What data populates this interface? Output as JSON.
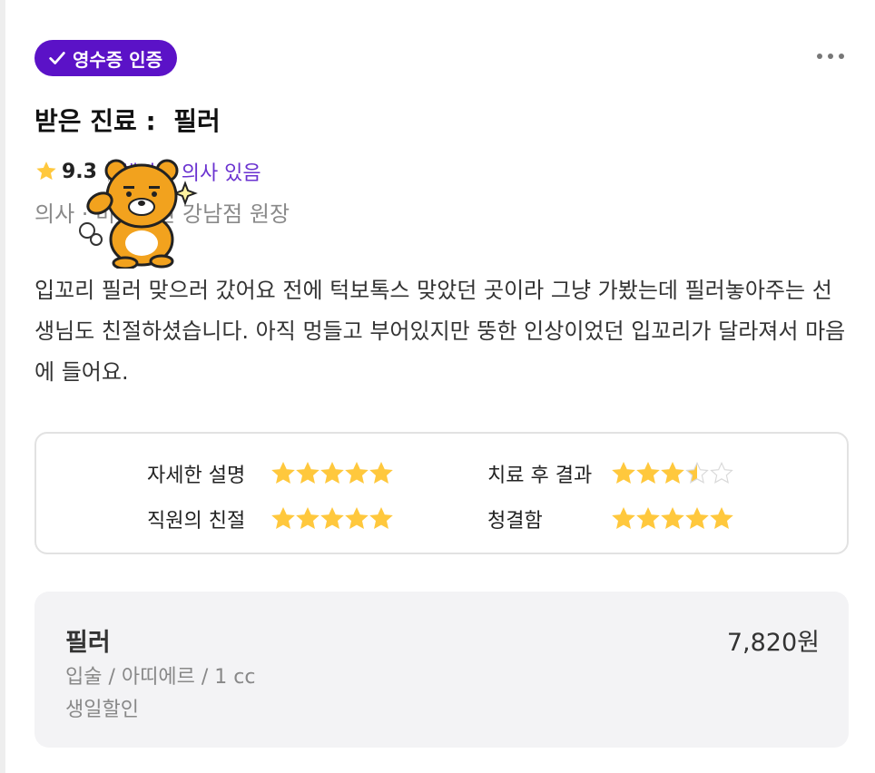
{
  "review": {
    "badge_label": "영수증 인증",
    "title": "받은 진료 :  필러",
    "rating": "9.3",
    "doctor_link": "해당문 의사 있음",
    "doctor_info": "의사 · 미인의원 강남점 원장",
    "text": "입꼬리 필러 맞으러 갔어요 전에 턱보톡스 맞았던 곳이라 그냥 가봤는데 필러놓아주는 선생님도 친절하셨습니다. 아직 멍들고 부어있지만 뚱한 인상이었던 입꼬리가 달라져서 마음에 들어요."
  },
  "scores": [
    {
      "label": "자세한 설명",
      "stars": 5
    },
    {
      "label": "치료 후 결과",
      "stars": 3.5
    },
    {
      "label": "직원의 친절",
      "stars": 5
    },
    {
      "label": "청결함",
      "stars": 5
    }
  ],
  "price": {
    "name": "필러",
    "amount": "7,820원",
    "detail": "입술 / 아띠에르 / 1 cc",
    "tag": "생일할인"
  },
  "colors": {
    "badge": "#5b12c7",
    "link": "#6a32d0",
    "star": "#ffc83d",
    "star_empty": "#d9d9d9"
  },
  "icons": [
    "check-icon",
    "more-icon",
    "star-icon",
    "character-sticker"
  ]
}
